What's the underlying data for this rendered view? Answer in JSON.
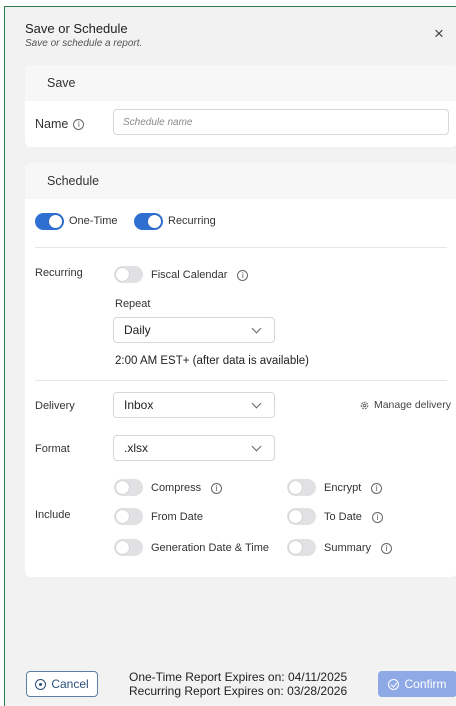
{
  "dialog": {
    "title": "Save or Schedule",
    "subtitle": "Save or schedule a report.",
    "close_glyph": "×"
  },
  "save": {
    "heading": "Save",
    "name_label": "Name",
    "name_value": "",
    "name_placeholder": "Schedule name"
  },
  "schedule": {
    "heading": "Schedule",
    "one_time_label": "One-Time",
    "one_time_on": true,
    "recurring_toggle_label": "Recurring",
    "recurring_on": true,
    "recurring_row_label": "Recurring",
    "fiscal_calendar_label": "Fiscal Calendar",
    "fiscal_calendar_on": false,
    "repeat_label": "Repeat",
    "repeat_value": "Daily",
    "time_note": "2:00 AM EST+ (after data is available)",
    "delivery_label": "Delivery",
    "delivery_value": "Inbox",
    "manage_delivery_label": "Manage delivery",
    "format_label": "Format",
    "format_value": ".xlsx",
    "include_label": "Include",
    "include_options": {
      "compress": "Compress",
      "encrypt": "Encrypt",
      "from_date": "From Date",
      "to_date": "To Date",
      "generation_date_time": "Generation Date & Time",
      "summary": "Summary"
    }
  },
  "footer": {
    "cancel_label": "Cancel",
    "one_time_expiry": "One-Time Report Expires on: 04/11/2025",
    "recurring_expiry": "Recurring Report Expires on: 03/28/2026",
    "confirm_label": "Confirm"
  },
  "colors": {
    "toggle_on": "#2f6fd1",
    "toggle_off": "#e1e1e4",
    "confirm_bg": "#8fa9e6",
    "cancel_border": "#5e7ea8"
  },
  "icons": [
    "close-icon",
    "info-icon",
    "chevron-down-icon",
    "gear-icon",
    "cancel-circle-icon",
    "check-circle-icon"
  ]
}
